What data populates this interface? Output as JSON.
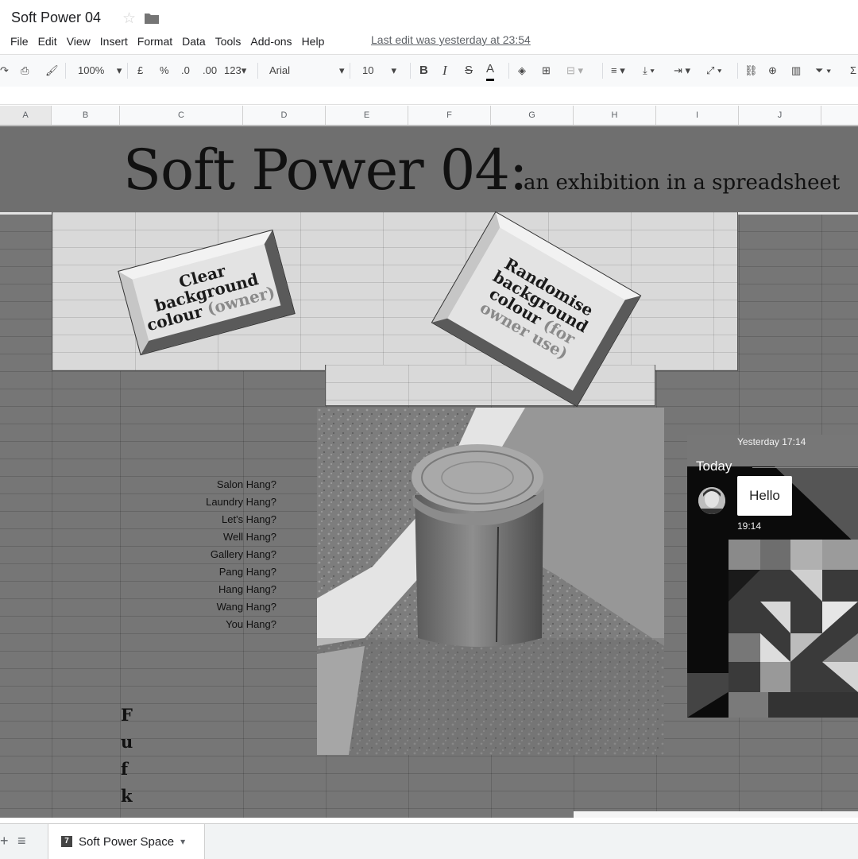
{
  "doc": {
    "title": "Soft Power 04",
    "last_edit": "Last edit was yesterday at 23:54"
  },
  "menu": [
    "File",
    "Edit",
    "View",
    "Insert",
    "Format",
    "Data",
    "Tools",
    "Add-ons",
    "Help"
  ],
  "toolbar": {
    "zoom": "100%",
    "currency": "£",
    "percent": "%",
    "dec_less": ".0",
    "dec_more": ".00",
    "format_more": "123",
    "font": "Arial",
    "font_size": "10",
    "bold": "B",
    "italic": "I",
    "strike": "S",
    "text_color": "A"
  },
  "columns": [
    "A",
    "B",
    "C",
    "D",
    "E",
    "F",
    "G",
    "H",
    "I",
    "J"
  ],
  "sheet": {
    "title": "Soft Power 04:",
    "subtitle": "an exhibition in a spreadsheet",
    "button_clear": {
      "line1": "Clear",
      "line2": "background",
      "line3": "colour",
      "suffix": "(owner)"
    },
    "button_random": {
      "line1": "Randomise",
      "line2": "background",
      "line3": "colour",
      "suffix1": "(for",
      "suffix2": "owner use)"
    },
    "hangs": [
      "Salon Hang?",
      "Laundry Hang?",
      "Let's Hang?",
      "Well Hang?",
      "Gallery Hang?",
      "Pang Hang?",
      "Hang Hang?",
      "Wang Hang?",
      "You Hang?"
    ],
    "vertical_letters": [
      "F",
      "u",
      "f",
      "k"
    ]
  },
  "chat": {
    "timestamp_top": "Yesterday 17:14",
    "day_label": "Today",
    "message": "Hello",
    "message_time": "19:14"
  },
  "tabs": {
    "active_sheet": "Soft Power Space",
    "tab_badge": "7"
  },
  "colors": {
    "background": "#767676",
    "panel": "#d9d9d9",
    "header": "#f8f9fa"
  }
}
